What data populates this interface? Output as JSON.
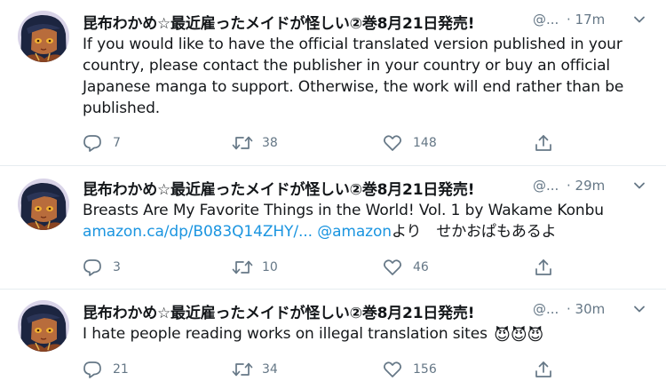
{
  "tweets": [
    {
      "display_name": "昆布わかめ☆最近雇ったメイドが怪しい②巻8月21日発売!",
      "handle": "@...",
      "timestamp": "· 17m",
      "text_plain": "If you would like to have the official translated version published in your country, please contact the publisher in your country or buy an official Japanese manga to support. Otherwise, the work will end rather than be published.",
      "replies": "7",
      "retweets": "38",
      "likes": "148"
    },
    {
      "display_name": "昆布わかめ☆最近雇ったメイドが怪しい②巻8月21日発売!",
      "handle": "@...",
      "timestamp": "· 29m",
      "text_plain": "Breasts Are My Favorite Things in the World! Vol. 1 by Wakame Konbu",
      "link_url": "amazon.ca/dp/B083Q14ZHY/...",
      "mention": "@amazon",
      "text_suffix": "より　せかおぱもあるよ",
      "replies": "3",
      "retweets": "10",
      "likes": "46"
    },
    {
      "display_name": "昆布わかめ☆最近雇ったメイドが怪しい②巻8月21日発売!",
      "handle": "@...",
      "timestamp": "· 30m",
      "text_plain": "I hate people reading works on illegal translation sites",
      "emoji": "😈😈😈",
      "replies": "21",
      "retweets": "34",
      "likes": "156"
    }
  ],
  "icons": {
    "reply": "speech-bubble-icon",
    "retweet": "retweet-arrows-icon",
    "like": "heart-outline-icon",
    "share": "share-upload-icon",
    "menu": "chevron-down-icon"
  },
  "colors": {
    "text": "#14171a",
    "muted": "#657786",
    "link": "#1b95e0",
    "divider": "#e6ecf0",
    "avatar_bg": "#1c2540"
  }
}
